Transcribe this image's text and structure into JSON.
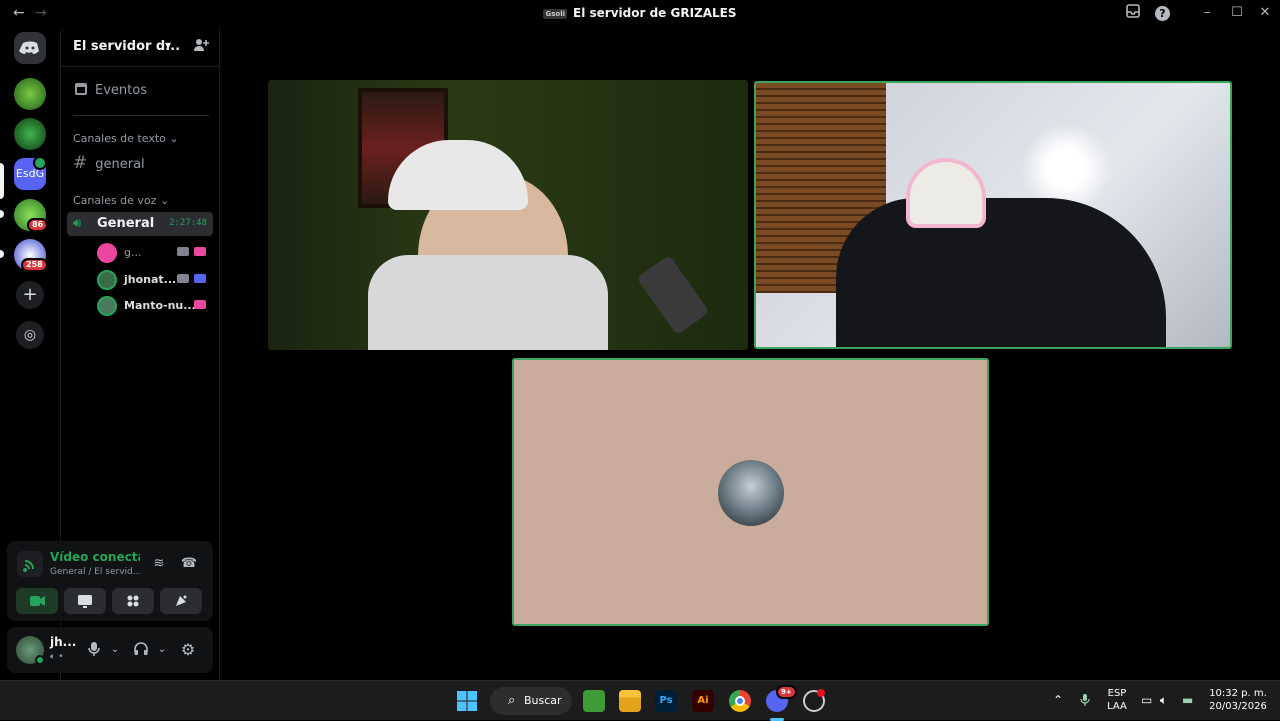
{
  "window": {
    "title": "El servidor de GRIZALES",
    "server_tag": "Gsoli",
    "back_icon": "arrow-left-icon",
    "forward_icon": "arrow-right-icon"
  },
  "rail": {
    "badges": [
      "86",
      "258"
    ],
    "active_server_label": "EsdG"
  },
  "sidebar": {
    "server_name": "El servidor d...",
    "events_label": "Eventos",
    "text_category": "Canales de texto",
    "text_channels": [
      "general"
    ],
    "voice_category": "Canales de voz",
    "voice_channel": {
      "name": "General",
      "timer": "2:27:48",
      "users": [
        {
          "name": "g...",
          "avatar_color": "#eb459e"
        },
        {
          "name": "jhonat...",
          "avatar_color": "#3a6b47"
        },
        {
          "name": "Manto-nu...",
          "avatar_color": "#4a7a5c"
        }
      ]
    }
  },
  "voice_panel": {
    "status": "Vídeo conectac",
    "location": "General / El servid..."
  },
  "user": {
    "name": "jh...",
    "sub": "•"
  },
  "colors": {
    "accent_green": "#23a55a",
    "speaking_border": "#3ba55c",
    "discord_blurple": "#5865f2",
    "danger": "#da373c",
    "tile3_bg": "#c9ac9b"
  },
  "taskbar": {
    "search_label": "Buscar",
    "discord_badge": "9+",
    "lang_top": "ESP",
    "lang_bottom": "LAA",
    "time": "10:32 p. m.",
    "date": "20/03/2026"
  }
}
